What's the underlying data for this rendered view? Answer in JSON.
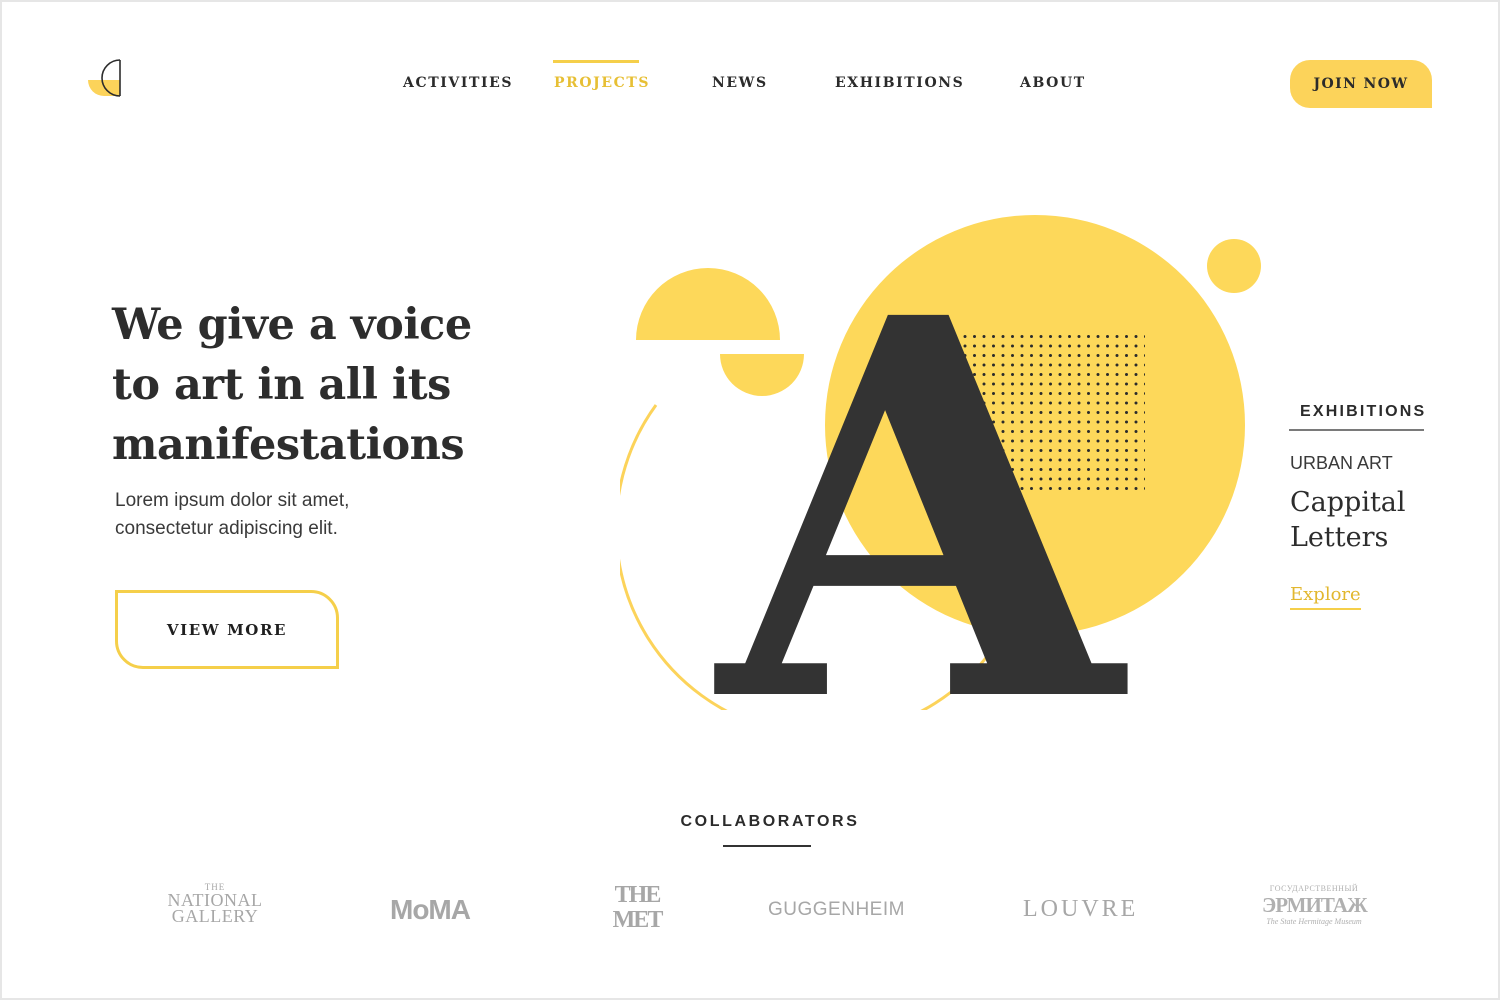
{
  "nav": {
    "items": [
      {
        "label": "ACTIVITIES",
        "active": false
      },
      {
        "label": "PROJECTS",
        "active": true
      },
      {
        "label": "NEWS",
        "active": false
      },
      {
        "label": "EXHIBITIONS",
        "active": false
      },
      {
        "label": "ABOUT",
        "active": false
      }
    ],
    "join_label": "JOIN NOW"
  },
  "hero": {
    "title_lines": [
      "We give a voice",
      "to art in all its",
      "manifestations"
    ],
    "subtitle_lines": [
      "Lorem ipsum dolor sit amet,",
      "consectetur adipiscing elit."
    ],
    "button_label": "VIEW MORE",
    "letter": "A"
  },
  "side": {
    "label": "EXHIBITIONS",
    "category": "URBAN ART",
    "title_lines": [
      "Cappital",
      "Letters"
    ],
    "link_label": "Explore"
  },
  "collaborators": {
    "label": "COLLABORATORS",
    "logos": {
      "national_gallery": {
        "small": "THE",
        "big_lines": [
          "NATIONAL",
          "GALLERY"
        ]
      },
      "moma": "MoMA",
      "met": {
        "lines": [
          "THE",
          "MET"
        ]
      },
      "guggenheim": "GUGGENHEIM",
      "louvre": "LOUVRE",
      "hermitage": {
        "small": "ГОСУДАРСТВЕННЫЙ",
        "big": "ЭРМИТАЖ",
        "sub": "The State Hermitage Museum"
      }
    }
  },
  "colors": {
    "accent": "#fcd35a",
    "accent_text": "#e7bf34",
    "dark": "#333333",
    "logo_gray": "#a7a7a7"
  }
}
